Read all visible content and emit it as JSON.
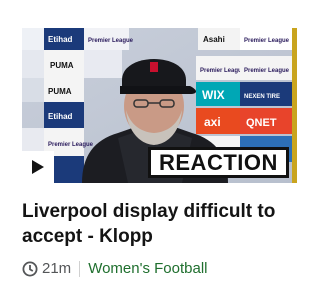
{
  "video": {
    "badge": "REACTION",
    "play_icon": "play-icon",
    "board_words": [
      "Etihad",
      "Premier League",
      "PUMA",
      "Asahi",
      "WIX",
      "NEXEN TIRE",
      "axi",
      "QNET"
    ]
  },
  "article": {
    "headline": "Liverpool display difficult to accept - Klopp",
    "age": "21m",
    "age_icon": "clock-icon",
    "section": "Women's Football",
    "section_color": "#1f6f2e"
  }
}
